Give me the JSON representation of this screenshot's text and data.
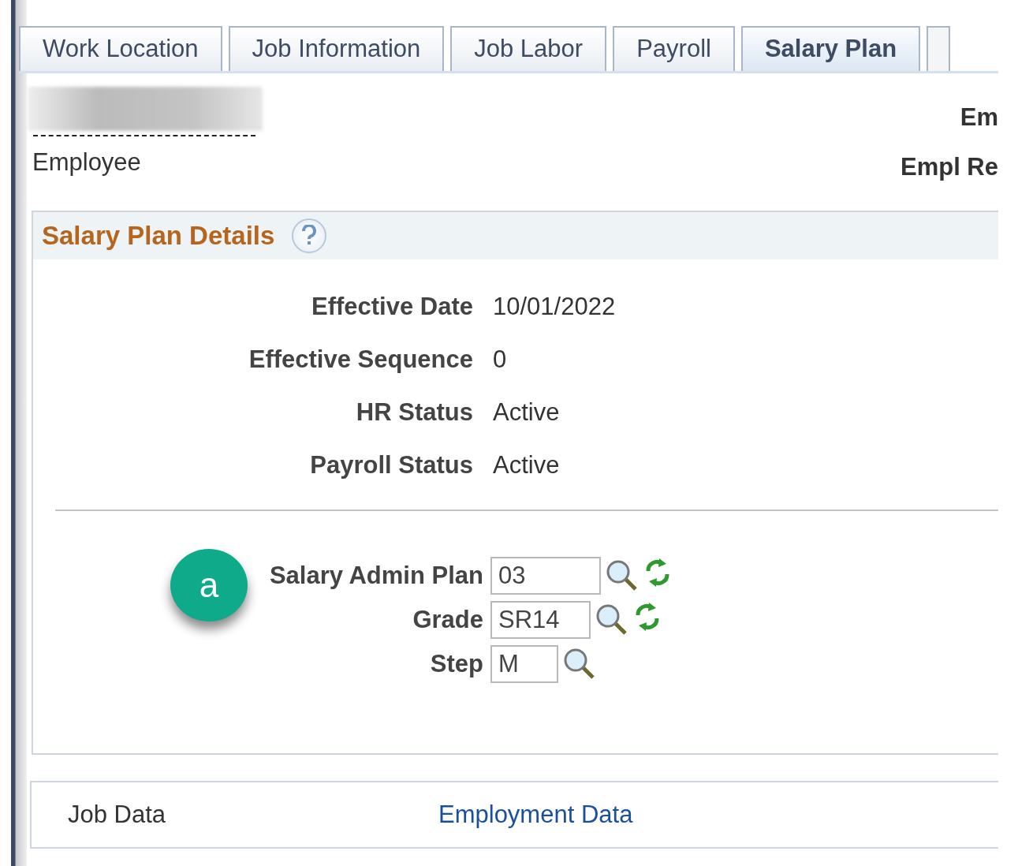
{
  "tabs": [
    {
      "label": "Work Location",
      "selected": false
    },
    {
      "label": "Job Information",
      "selected": false
    },
    {
      "label": "Job Labor",
      "selected": false
    },
    {
      "label": "Payroll",
      "selected": false
    },
    {
      "label": "Salary Plan",
      "selected": true
    }
  ],
  "employee": {
    "label": "Employee",
    "right_labels": [
      "Em",
      "Empl Re"
    ]
  },
  "section": {
    "title": "Salary Plan Details",
    "details": [
      {
        "label": "Effective Date",
        "value": "10/01/2022"
      },
      {
        "label": "Effective Sequence",
        "value": "0"
      },
      {
        "label": "HR Status",
        "value": "Active"
      },
      {
        "label": "Payroll Status",
        "value": "Active"
      }
    ],
    "marker": "a",
    "fields": [
      {
        "label": "Salary Admin Plan",
        "value": "03",
        "refresh": true
      },
      {
        "label": "Grade",
        "value": "SR14",
        "refresh": true
      },
      {
        "label": "Step",
        "value": "M",
        "refresh": false
      }
    ]
  },
  "footer_links": [
    {
      "label": "Job Data",
      "kind": "plain"
    },
    {
      "label": "Employment Data",
      "kind": "link"
    }
  ]
}
